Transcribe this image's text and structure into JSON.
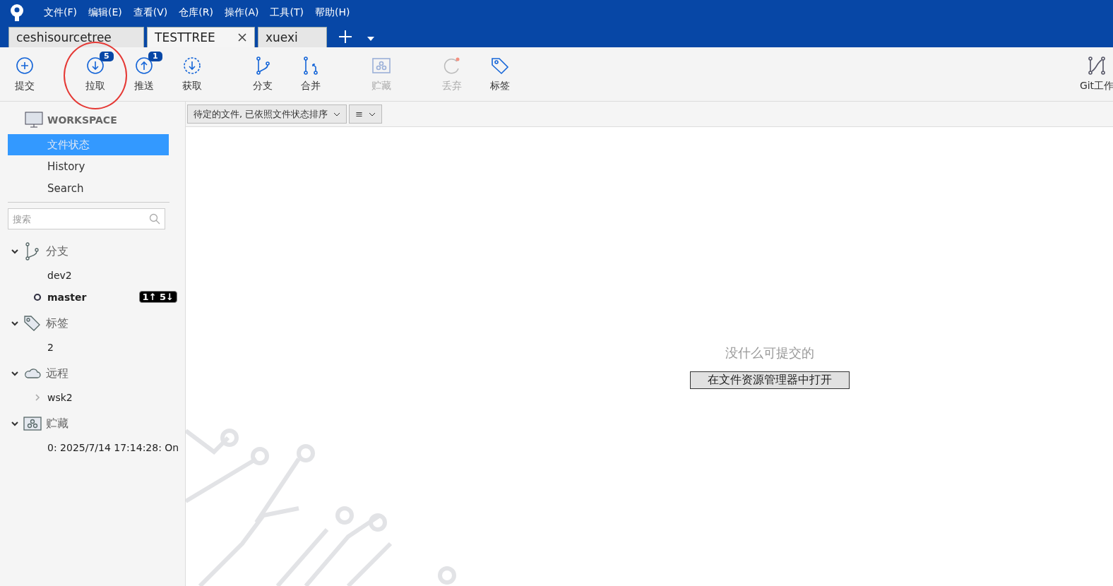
{
  "menu": [
    "文件(F)",
    "编辑(E)",
    "查看(V)",
    "仓库(R)",
    "操作(A)",
    "工具(T)",
    "帮助(H)"
  ],
  "tabs": [
    {
      "label": "ceshisourcetree",
      "selected": false
    },
    {
      "label": "TESTTREE",
      "selected": true
    },
    {
      "label": "xuexi",
      "selected": false
    }
  ],
  "toolbar": [
    {
      "kind": "commit",
      "label": "提交",
      "disabled": false
    },
    {
      "kind": "pull",
      "label": "拉取",
      "disabled": false,
      "badge": "5",
      "annotated": true
    },
    {
      "kind": "push",
      "label": "推送",
      "disabled": false,
      "badge": "1"
    },
    {
      "kind": "fetch",
      "label": "获取",
      "disabled": false
    },
    {
      "kind": "branch",
      "label": "分支",
      "disabled": false
    },
    {
      "kind": "merge",
      "label": "合并",
      "disabled": false
    },
    {
      "kind": "stash",
      "label": "贮藏",
      "disabled": true
    },
    {
      "kind": "discard",
      "label": "丢弃",
      "disabled": true
    },
    {
      "kind": "tag",
      "label": "标签",
      "disabled": false
    }
  ],
  "toolbar_right": {
    "kind": "gitflow",
    "label": "Git工作"
  },
  "sidebar": {
    "workspace": "WORKSPACE",
    "items": [
      {
        "label": "文件状态",
        "selected": true
      },
      {
        "label": "History",
        "selected": false
      },
      {
        "label": "Search",
        "selected": false
      }
    ],
    "search": {
      "placeholder": "搜索"
    },
    "sections": [
      {
        "kind": "branch",
        "label": "分支",
        "expanded": true,
        "children": [
          {
            "label": "dev2",
            "current": false
          },
          {
            "label": "master",
            "current": true,
            "badge": "1↑ 5↓"
          }
        ]
      },
      {
        "kind": "tag",
        "label": "标签",
        "expanded": true,
        "children": [
          {
            "label": "2"
          }
        ]
      },
      {
        "kind": "remote",
        "label": "远程",
        "expanded": true,
        "children": [
          {
            "label": "wsk2",
            "expandable": true
          }
        ]
      },
      {
        "kind": "stash",
        "label": "贮藏",
        "expanded": true,
        "children": [
          {
            "label": "0: 2025/7/14 17:14:28: On"
          }
        ]
      }
    ]
  },
  "filter": {
    "sort": "待定的文件, 已依照文件状态排序",
    "view": "≡"
  },
  "empty": {
    "message": "没什么可提交的",
    "button": "在文件资源管理器中打开"
  }
}
